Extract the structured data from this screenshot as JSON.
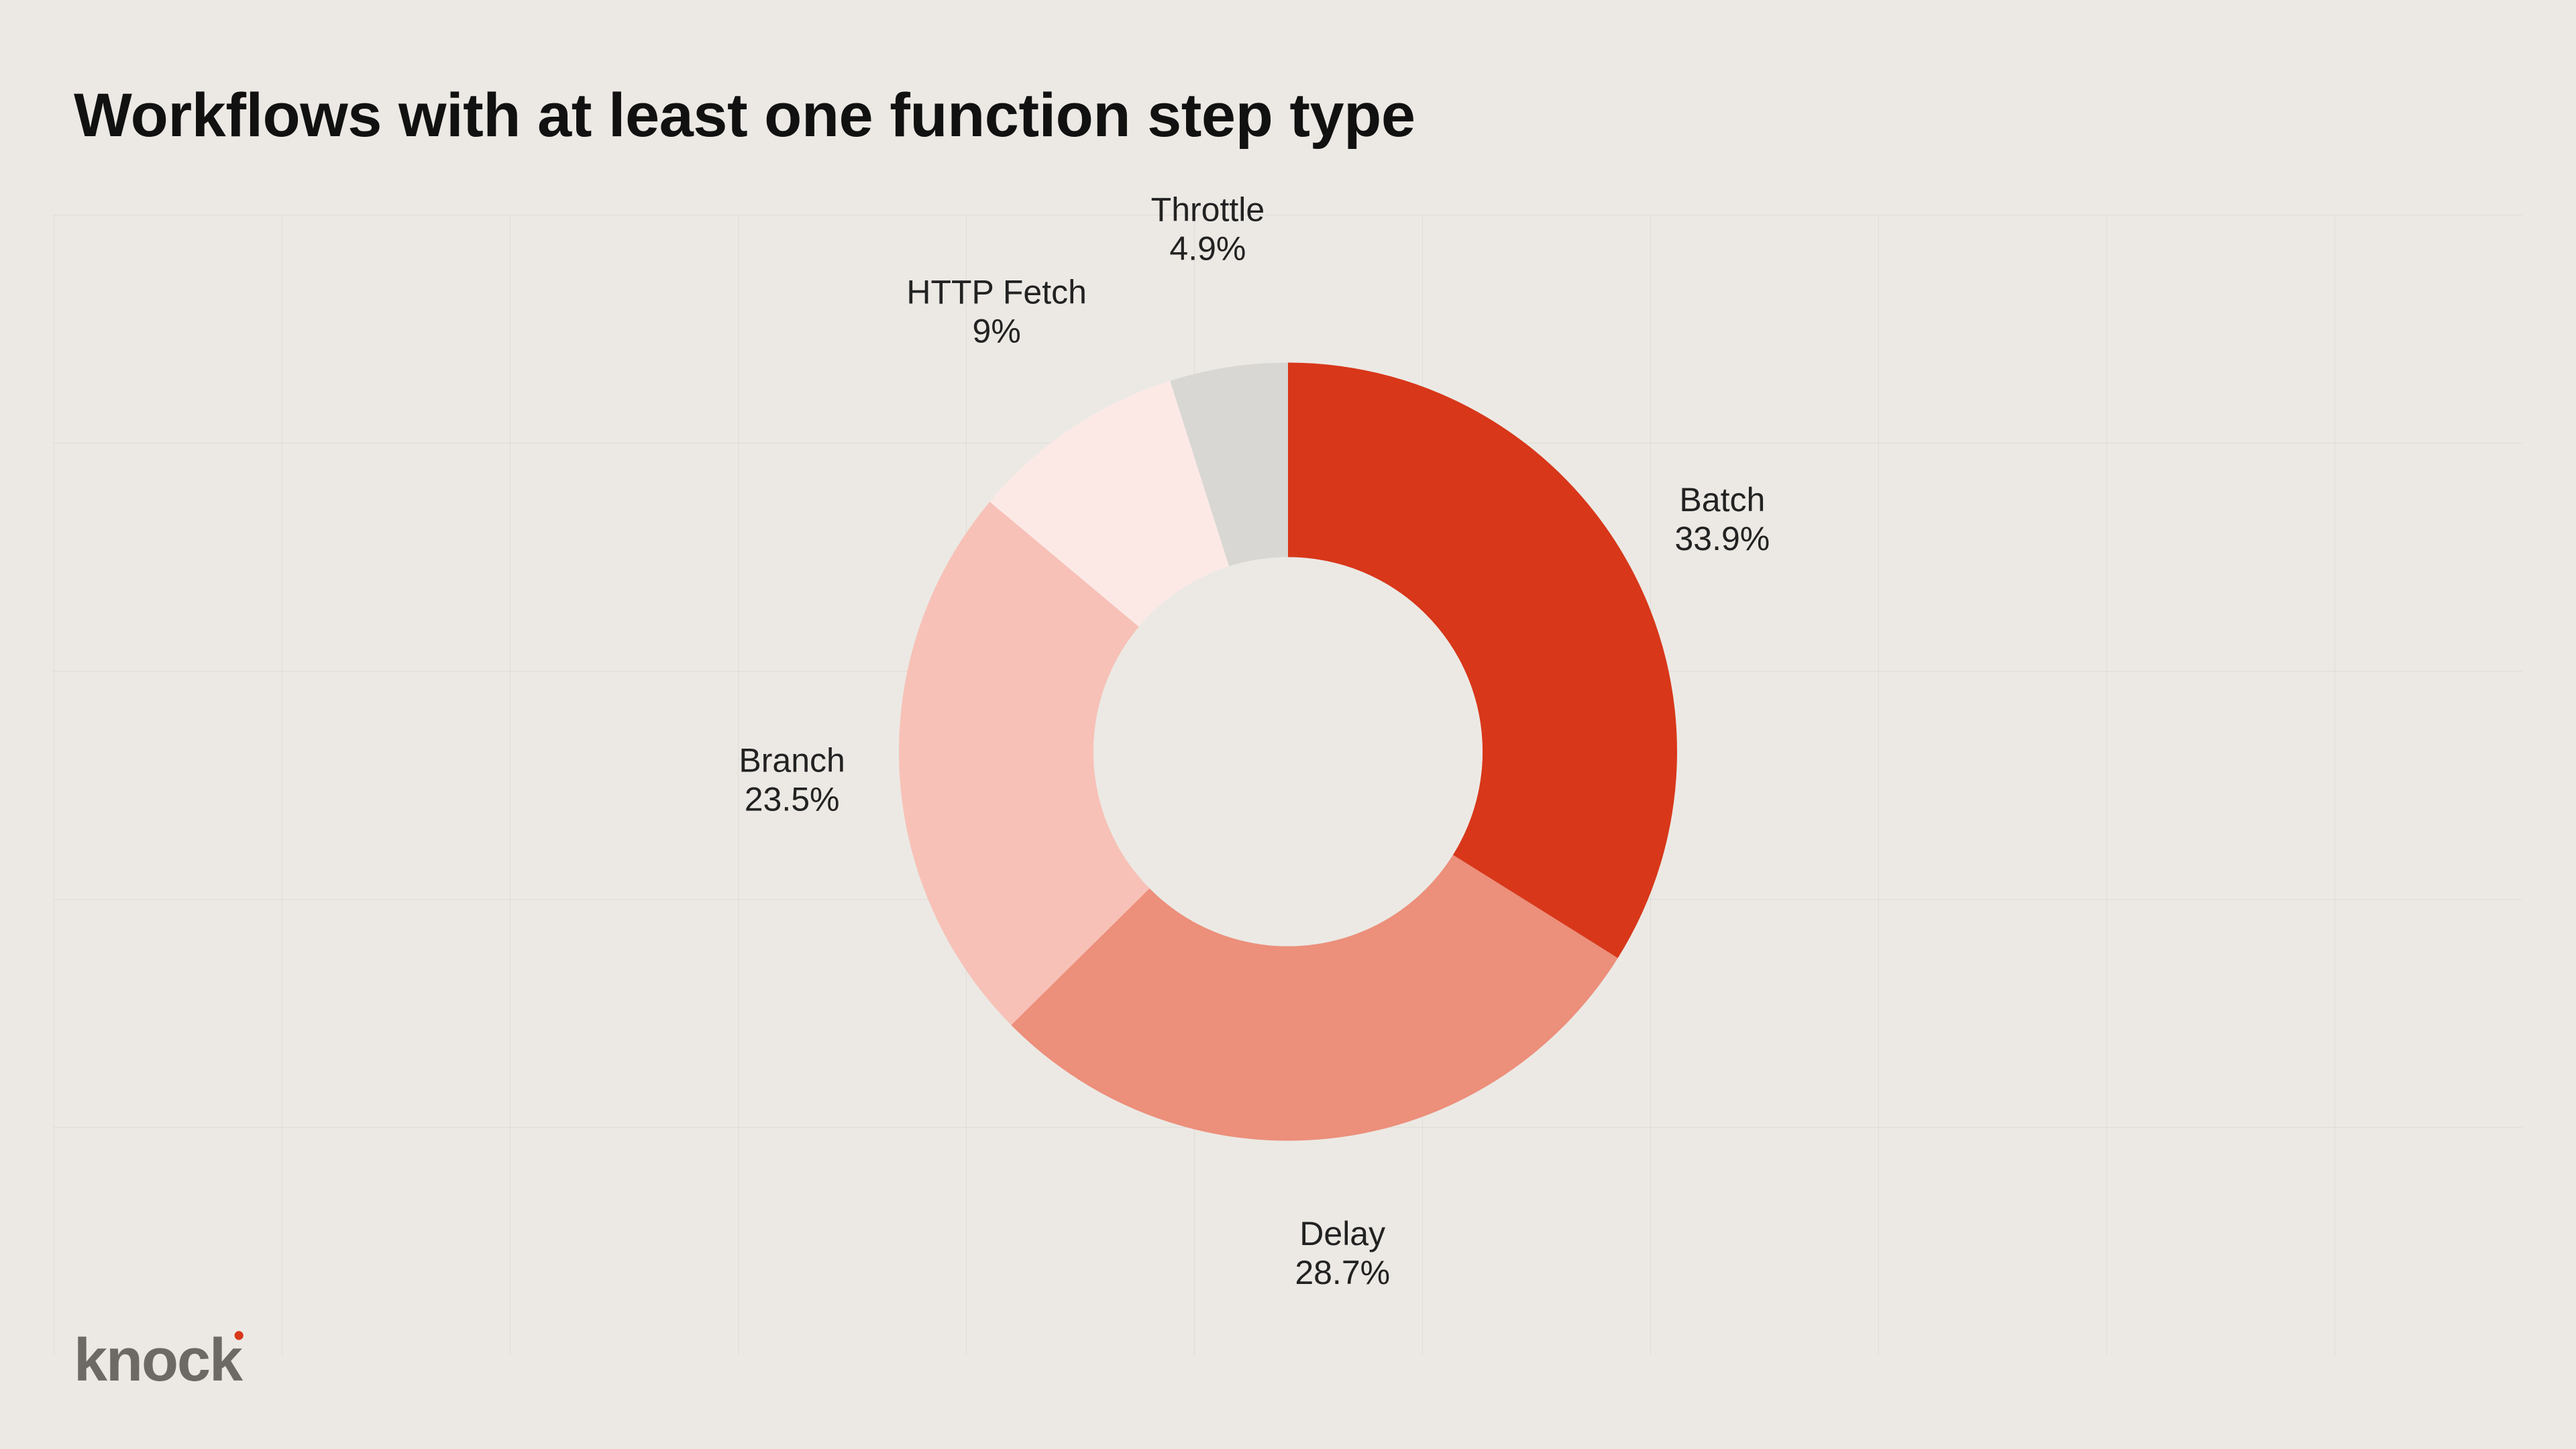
{
  "title": "Workflows with at least one function step type",
  "brand": "knock",
  "chart_data": {
    "type": "pie",
    "title": "Workflows with at least one function step type",
    "inner_radius_ratio": 0.5,
    "series": [
      {
        "name": "Batch",
        "value": 33.9,
        "label": "33.9%",
        "color": "#d8371a"
      },
      {
        "name": "Delay",
        "value": 28.7,
        "label": "28.7%",
        "color": "#ec8f7b"
      },
      {
        "name": "Branch",
        "value": 23.5,
        "label": "23.5%",
        "color": "#f7c1b7"
      },
      {
        "name": "HTTP Fetch",
        "value": 9.0,
        "label": "9%",
        "color": "#fce9e6"
      },
      {
        "name": "Throttle",
        "value": 4.9,
        "label": "4.9%",
        "color": "#d8d7d3"
      }
    ]
  }
}
